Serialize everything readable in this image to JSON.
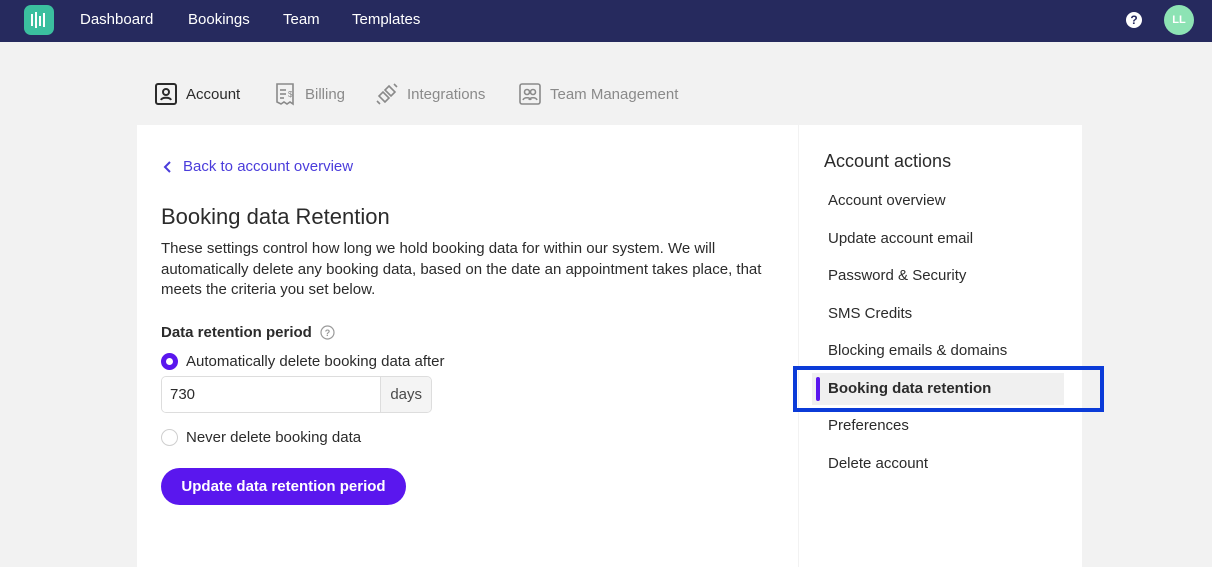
{
  "nav": {
    "links": [
      "Dashboard",
      "Bookings",
      "Team",
      "Templates"
    ],
    "help_symbol": "?",
    "avatar_initials": "LL",
    "logo_icon": "bars-logo-icon",
    "colors": {
      "bar": "#262a5e",
      "logo": "#3bbf9f",
      "avatar": "#8de3b4"
    }
  },
  "tabs": [
    {
      "label": "Account",
      "icon": "user-card-icon",
      "active": true
    },
    {
      "label": "Billing",
      "icon": "receipt-icon",
      "active": false
    },
    {
      "label": "Integrations",
      "icon": "plug-icon",
      "active": false
    },
    {
      "label": "Team Management",
      "icon": "team-card-icon",
      "active": false
    }
  ],
  "main": {
    "back_link": "Back to account overview",
    "title": "Booking data Retention",
    "description": "These settings control how long we hold booking data for within our system. We will automatically delete any booking data, based on the date an appointment takes place, that meets the criteria you set below.",
    "field_label": "Data retention period",
    "option_auto": "Automatically delete booking data after",
    "days_value": "730",
    "days_suffix": "days",
    "option_never": "Never delete booking data",
    "selected_option": "auto",
    "button_label": "Update data retention period",
    "accent_color": "#5a17ee"
  },
  "sidebar": {
    "title": "Account actions",
    "items": [
      "Account overview",
      "Update account email",
      "Password & Security",
      "SMS Credits",
      "Blocking emails & domains",
      "Booking data retention",
      "Preferences",
      "Delete account"
    ],
    "active_index": 5,
    "highlight_color": "#0b3bd8"
  }
}
